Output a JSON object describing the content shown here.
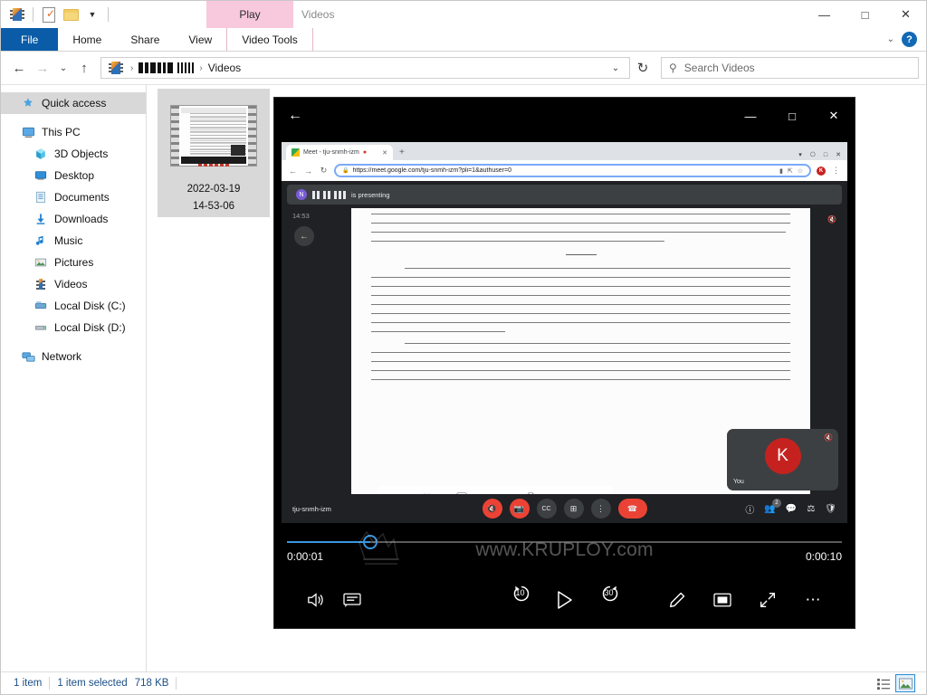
{
  "explorer": {
    "window_title": "Videos",
    "tab_group_header": "Play",
    "quick_access_toolbar": {
      "app_icon": "videos-folder-icon",
      "properties_icon": "properties-icon",
      "new_folder_icon": "new-folder-icon",
      "customize_icon": "chevron-down-icon"
    },
    "ribbon_tabs": [
      {
        "label": "File",
        "id": "file"
      },
      {
        "label": "Home",
        "id": "home"
      },
      {
        "label": "Share",
        "id": "share"
      },
      {
        "label": "View",
        "id": "view"
      },
      {
        "label": "Video Tools",
        "id": "video-tools"
      }
    ],
    "window_controls": {
      "minimize": "—",
      "maximize": "□",
      "close": "✕"
    },
    "ribbon_right": {
      "collapse": "⌄",
      "help": "?"
    },
    "address": {
      "back": "←",
      "forward": "→",
      "recent": "⌄",
      "up": "↑",
      "folder_icon": "videos-folder-icon",
      "crumb_redacted": "redacted-path",
      "crumb_current": "Videos",
      "dropdown": "⌄",
      "refresh": "↻"
    },
    "search": {
      "placeholder": "Search Videos",
      "icon": "search-icon"
    },
    "sidebar": {
      "items": [
        {
          "label": "Quick access",
          "icon": "star-pin-icon",
          "level": 0,
          "selected": true
        },
        {
          "label": "This PC",
          "icon": "monitor-icon",
          "level": 0,
          "selected": false
        },
        {
          "label": "3D Objects",
          "icon": "cube-icon",
          "level": 1,
          "selected": false
        },
        {
          "label": "Desktop",
          "icon": "desktop-icon",
          "level": 1,
          "selected": false
        },
        {
          "label": "Documents",
          "icon": "documents-icon",
          "level": 1,
          "selected": false
        },
        {
          "label": "Downloads",
          "icon": "download-arrow-icon",
          "level": 1,
          "selected": false
        },
        {
          "label": "Music",
          "icon": "music-note-icon",
          "level": 1,
          "selected": false
        },
        {
          "label": "Pictures",
          "icon": "picture-icon",
          "level": 1,
          "selected": false
        },
        {
          "label": "Videos",
          "icon": "film-icon",
          "level": 1,
          "selected": false
        },
        {
          "label": "Local Disk (C:)",
          "icon": "hard-drive-icon",
          "level": 1,
          "selected": false
        },
        {
          "label": "Local Disk (D:)",
          "icon": "hard-drive-icon",
          "level": 1,
          "selected": false
        },
        {
          "label": "Network",
          "icon": "network-icon",
          "level": 0,
          "selected": false
        }
      ]
    },
    "file_tile": {
      "name_line1": "2022-03-19",
      "name_line2": "14-53-06",
      "thumbnail_icon": "video-file-thumbnail"
    },
    "statusbar": {
      "item_count": "1 item",
      "selection": "1 item selected",
      "size": "718 KB",
      "views": [
        {
          "name": "details-view-button",
          "active": false
        },
        {
          "name": "large-icons-view-button",
          "active": true
        }
      ]
    }
  },
  "player": {
    "back_label": "←",
    "window_controls": {
      "minimize": "—",
      "maximize": "□",
      "close": "✕"
    },
    "time_elapsed": "0:00:01",
    "time_total": "0:00:10",
    "progress_percent": 15,
    "watermark": "www.KRUPLOY.com",
    "controls": [
      {
        "name": "volume-button",
        "glyph": "🔊"
      },
      {
        "name": "closed-captions-button",
        "glyph": "cc"
      },
      {
        "name": "rewind-10-button",
        "glyph": "10"
      },
      {
        "name": "play-button",
        "glyph": "▷"
      },
      {
        "name": "forward-30-button",
        "glyph": "30"
      },
      {
        "name": "edit-button",
        "glyph": "✎"
      },
      {
        "name": "mini-view-button",
        "glyph": "pip"
      },
      {
        "name": "fullscreen-button",
        "glyph": "⤡"
      },
      {
        "name": "more-options-button",
        "glyph": "⋯"
      }
    ]
  },
  "recording": {
    "browser": {
      "tab_title": "Meet - tju-snmh-izm",
      "tab_mute_icon": "mute-tab-icon",
      "tab_close_icon": "close-icon",
      "new_tab_icon": "plus-icon",
      "nav": {
        "back": "←",
        "forward": "→",
        "reload": "↻"
      },
      "url": "https://meet.google.com/tju-snmh-izm?pli=1&authuser=0",
      "lock_icon": "lock-icon",
      "omnibox_right": [
        "media-cast-icon",
        "share-icon",
        "bookmark-star-icon"
      ],
      "profile_initial": "K",
      "menu_icon": "kebab-menu-icon",
      "window_controls": {
        "minimize": "—",
        "maximize": "□",
        "close": "✕"
      }
    },
    "meet": {
      "presenting_banner_text": "is presenting",
      "presenter_avatar_initial": "N",
      "presenter_name_redacted": "redacted-name",
      "clock": "14:53",
      "meeting_code": "tju-snmh-izm",
      "self_tile": {
        "initial": "K",
        "label": "You",
        "mic_icon": "mic-off-icon"
      },
      "center_controls": [
        {
          "name": "mic-off-button",
          "glyph": "🎤",
          "style": "red"
        },
        {
          "name": "camera-off-button",
          "glyph": "📷",
          "style": "red"
        },
        {
          "name": "captions-button",
          "glyph": "cc",
          "style": "grey"
        },
        {
          "name": "present-now-button",
          "glyph": "⬚",
          "style": "grey"
        },
        {
          "name": "more-options-button",
          "glyph": "⋮",
          "style": "grey"
        },
        {
          "name": "end-call-button",
          "glyph": "⌕",
          "style": "hangup"
        }
      ],
      "right_controls": [
        {
          "name": "meeting-details-button",
          "glyph": "ⓘ",
          "badge": ""
        },
        {
          "name": "show-everyone-button",
          "glyph": "👥",
          "badge": "2"
        },
        {
          "name": "chat-button",
          "glyph": "💬",
          "badge": ""
        },
        {
          "name": "activities-button",
          "glyph": "⚙",
          "badge": ""
        },
        {
          "name": "host-controls-button",
          "glyph": "🛡",
          "badge": ""
        }
      ],
      "pdf_toolbar_icons": [
        "fit-page-icon",
        "thumbnails-icon",
        "present-icon",
        "annotate-icon",
        "print-icon",
        "search-icon",
        "share-icon"
      ]
    }
  },
  "colors": {
    "accent": "#0a5ca8",
    "tab_group_pink": "#f8c8dc",
    "seek_blue": "#3a96dd",
    "meet_red": "#ea4335",
    "avatar_red": "#c5221f",
    "status_text": "#1a4f87"
  }
}
